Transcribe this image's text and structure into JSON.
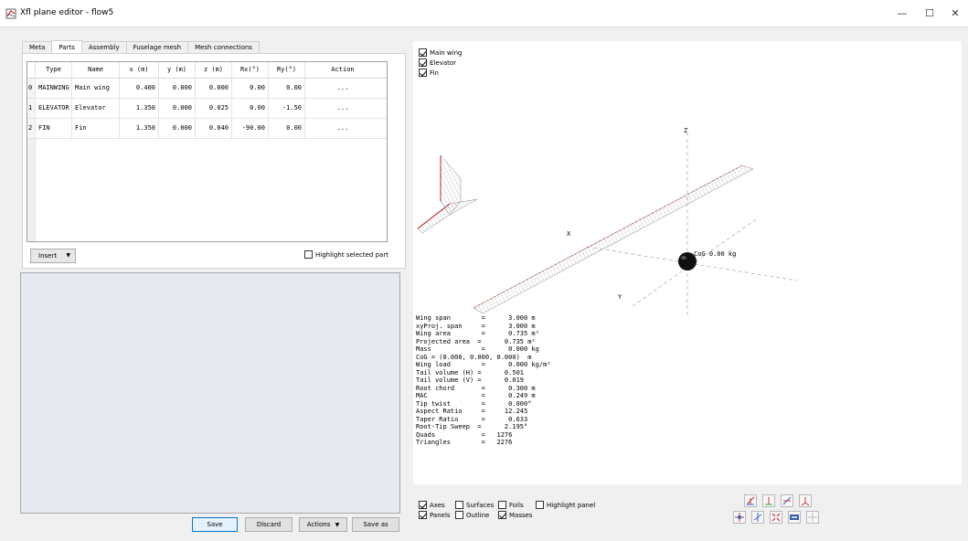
{
  "window": {
    "title": "Xfl plane editor - flow5",
    "icon": "flow5-app-icon",
    "controls": {
      "minimize": "—",
      "maximize": "☐",
      "close": "✕"
    }
  },
  "tabs": [
    {
      "label": "Meta",
      "active": false
    },
    {
      "label": "Parts",
      "active": true
    },
    {
      "label": "Assembly",
      "active": false
    },
    {
      "label": "Fuselage mesh",
      "active": false
    },
    {
      "label": "Mesh connections",
      "active": false
    }
  ],
  "parts_table": {
    "headers": [
      "Type",
      "Name",
      "x (m)",
      "y (m)",
      "z (m)",
      "Rx(°)",
      "Ry(°)",
      "Action"
    ],
    "rows": [
      {
        "index": "0",
        "type": "MAINWING",
        "name": "Main wing",
        "x": "0.400",
        "y": "0.000",
        "z": "0.000",
        "rx": "0.00",
        "ry": "0.00",
        "action": "..."
      },
      {
        "index": "1",
        "type": "ELEVATOR",
        "name": "Elevator",
        "x": "1.350",
        "y": "0.000",
        "z": "0.025",
        "rx": "0.00",
        "ry": "-1.50",
        "action": "..."
      },
      {
        "index": "2",
        "type": "FIN",
        "name": "Fin",
        "x": "1.350",
        "y": "0.000",
        "z": "0.040",
        "rx": "-90.00",
        "ry": "0.00",
        "action": "..."
      }
    ]
  },
  "insert_button": {
    "label": "Insert",
    "arrow": "▼"
  },
  "highlight_selected_part": {
    "label": "Highlight selected part",
    "checked": false
  },
  "bottom_buttons": {
    "save": "Save",
    "discard": "Discard",
    "actions": "Actions",
    "actions_arrow": "▼",
    "save_as": "Save as"
  },
  "view3d": {
    "visibility": [
      {
        "label": "Main wing",
        "checked": true
      },
      {
        "label": "Elevator",
        "checked": true
      },
      {
        "label": "Fin",
        "checked": true
      }
    ],
    "axes": {
      "x": "X",
      "y": "Y",
      "z": "Z"
    },
    "cog_label": "CoG 0.00 kg",
    "stats": [
      "Wing span        =      3.000 m",
      "xyProj. span     =      3.000 m",
      "Wing area        =      0.735 m²",
      "Projected area  =      0.735 m²",
      "Mass             =      0.000 kg",
      "CoG = (0.000, 0.000, 0.000)  m",
      "Wing load        =      0.000 kg/m²",
      "Tail volume (H) =      0.501",
      "Tail volume (V) =      0.019",
      "Root chord       =      0.300 m",
      "MAC              =      0.249 m",
      "Tip twist        =      0.000°",
      "Aspect Ratio     =     12.245",
      "Taper Ratio      =      0.633",
      "Root-Tip Sweep  =      2.195°",
      "Quads            =   1276",
      "Triangles        =   2276"
    ],
    "display_options": {
      "axes": {
        "label": "Axes",
        "checked": true
      },
      "surfaces": {
        "label": "Surfaces",
        "checked": false
      },
      "foils": {
        "label": "Foils",
        "checked": false
      },
      "highlight_panel": {
        "label": "Highlight panel",
        "checked": false
      },
      "panels": {
        "label": "Panels",
        "checked": true
      },
      "outline": {
        "label": "Outline",
        "checked": false
      },
      "masses": {
        "label": "Masses",
        "checked": true
      }
    }
  },
  "colors": {
    "accent": "#0078d7",
    "mesh": "#9a9a9a",
    "leading_edge": "#b00000",
    "lower_panel_bg": "#e6e9ef"
  }
}
